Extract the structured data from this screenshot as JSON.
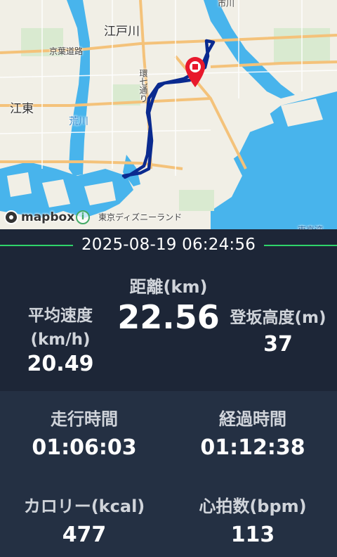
{
  "map": {
    "labels": {
      "edogawa": "江戸川",
      "keiyo_road": "京葉道路",
      "kanna": "環七通り",
      "koto": "江東",
      "arakawa": "荒川",
      "disneyland": "東京ディズニーランド",
      "ichikawa_partial": "市川",
      "tokyo_bay_partial": "東京湾"
    },
    "attribution": "mapbox",
    "colors": {
      "route": "#0a2a8f",
      "water": "#48b4ec",
      "pin": "#e8192c"
    }
  },
  "activity": {
    "datetime": "2025-08-19 06:24:56",
    "distance": {
      "label": "距離(km)",
      "value": "22.56"
    },
    "avg_speed": {
      "label": "平均速度(km/h)",
      "value": "20.49"
    },
    "elevation": {
      "label": "登坂高度(m)",
      "value": "37"
    },
    "moving_time": {
      "label": "走行時間",
      "value": "01:06:03"
    },
    "elapsed_time": {
      "label": "経過時間",
      "value": "01:12:38"
    },
    "calories": {
      "label": "カロリー(kcal)",
      "value": "477"
    },
    "heart_rate": {
      "label": "心拍数(bpm)",
      "value": "113"
    }
  }
}
